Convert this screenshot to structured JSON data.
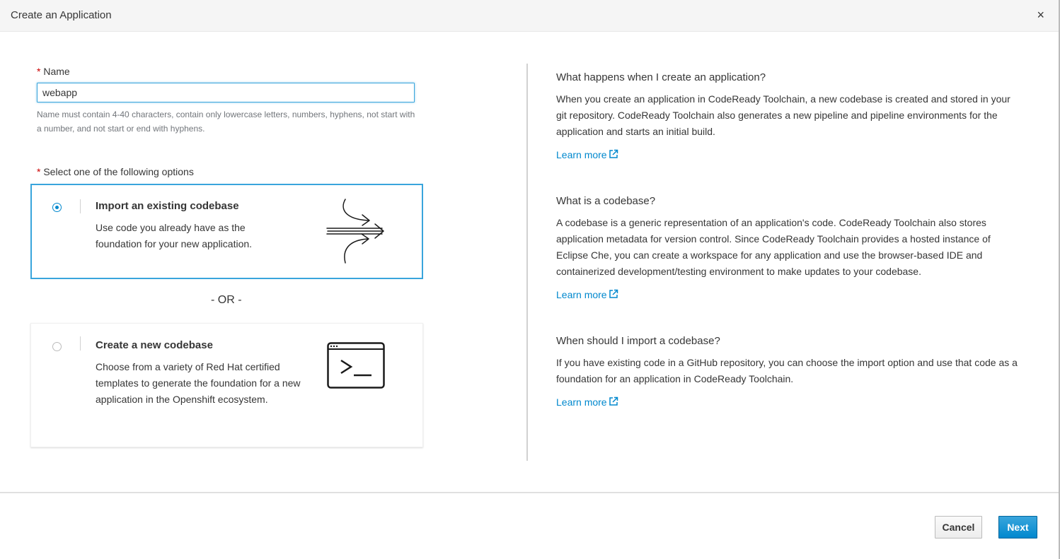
{
  "modal": {
    "title": "Create an Application",
    "close_glyph": "×"
  },
  "name_field": {
    "required_mark": "*",
    "label": "Name",
    "value": "webapp",
    "help": "Name must contain 4-40 characters, contain only lowercase letters, numbers, hyphens, not start with a number, and not start or end with hyphens."
  },
  "options": {
    "required_mark": "*",
    "label": "Select one of the following options",
    "separator": "- OR -",
    "items": [
      {
        "title": "Import an existing codebase",
        "description": "Use code you already have as the foundation for your new application.",
        "selected": true,
        "icon": "merge-arrows-icon"
      },
      {
        "title": "Create a new codebase",
        "description": "Choose from a variety of Red Hat certified templates to generate the foundation for a new application in the Openshift ecosystem.",
        "selected": false,
        "icon": "terminal-icon"
      }
    ]
  },
  "info": {
    "sections": [
      {
        "title": "What happens when I create an application?",
        "text": "When you create an application in CodeReady Toolchain, a new codebase is created and stored in your git repository. CodeReady Toolchain also generates a new pipeline and pipeline environments for the application and starts an initial build.",
        "link": "Learn more"
      },
      {
        "title": "What is a codebase?",
        "text": "A codebase is a generic representation of an application's code. CodeReady Toolchain also stores application metadata for version control. Since CodeReady Toolchain provides a hosted instance of Eclipse Che, you can create a workspace for any application and use the browser-based IDE and containerized development/testing environment to make updates to your codebase.",
        "link": "Learn more"
      },
      {
        "title": "When should I import a codebase?",
        "text": "If you have existing code in a GitHub repository, you can choose the import option and use that code as a foundation for an application in CodeReady Toolchain.",
        "link": "Learn more"
      }
    ]
  },
  "footer": {
    "cancel_label": "Cancel",
    "next_label": "Next"
  },
  "colors": {
    "accent": "#0088ce",
    "selected_border": "#39a5dc",
    "required": "#cc0000"
  }
}
